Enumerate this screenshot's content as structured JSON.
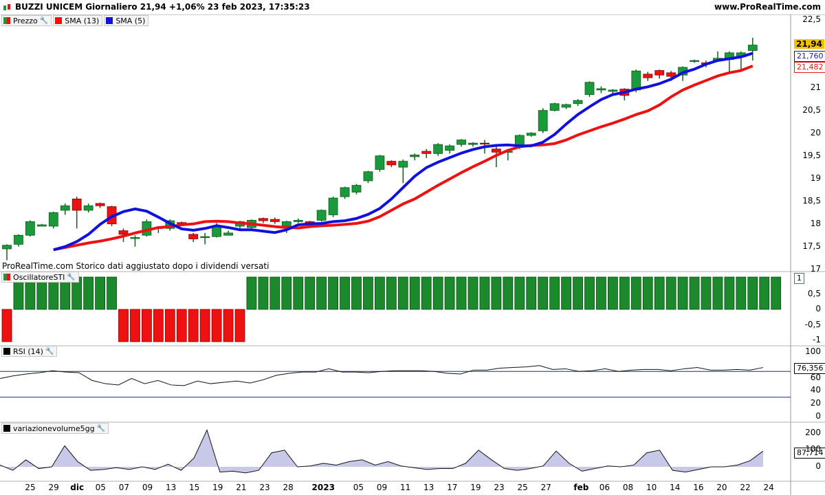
{
  "header": {
    "title": "BUZZI UNICEM Giornaliero 21,94 +1,06% 23 feb 2023, 17:35:23",
    "site": "www.ProRealTime.com"
  },
  "price_panel": {
    "legend": [
      {
        "label": "Prezzo",
        "color": "#1a9a3a",
        "icon": "candle-icon"
      },
      {
        "label": "SMA (13)",
        "color": "#ee1111",
        "icon": "square"
      },
      {
        "label": "SMA (5)",
        "color": "#1111dd",
        "icon": "square"
      }
    ],
    "footnote": "ProRealTime.com  Storico dati aggiustato dopo i dividendi versati",
    "last_price": "21,94",
    "sma5_value": "21,760",
    "sma13_value": "21,482",
    "y_ticks": [
      "22,5",
      "22",
      "21,5",
      "21",
      "20,5",
      "20",
      "19,5",
      "19",
      "18,5",
      "18",
      "17,5",
      "17"
    ]
  },
  "sti_panel": {
    "legend": "OscillatoreSTI",
    "value": "1",
    "y_ticks": [
      "0,5",
      "0",
      "-0,5",
      "-1"
    ]
  },
  "rsi_panel": {
    "legend": "RSI (14)",
    "value": "76,356",
    "y_ticks": [
      "100",
      "80",
      "60",
      "40",
      "20",
      "0"
    ]
  },
  "vol_panel": {
    "legend": "variazionevolume5gg",
    "value": "87,714",
    "y_ticks": [
      "200",
      "100",
      "0"
    ]
  },
  "x_axis": {
    "labels": [
      {
        "t": "25",
        "i": 2,
        "bold": false
      },
      {
        "t": "29",
        "i": 4,
        "bold": false
      },
      {
        "t": "dic",
        "i": 6,
        "bold": true
      },
      {
        "t": "05",
        "i": 8,
        "bold": false
      },
      {
        "t": "07",
        "i": 10,
        "bold": false
      },
      {
        "t": "09",
        "i": 12,
        "bold": false
      },
      {
        "t": "13",
        "i": 14,
        "bold": false
      },
      {
        "t": "15",
        "i": 16,
        "bold": false
      },
      {
        "t": "19",
        "i": 18,
        "bold": false
      },
      {
        "t": "21",
        "i": 20,
        "bold": false
      },
      {
        "t": "23",
        "i": 22,
        "bold": false
      },
      {
        "t": "28",
        "i": 24,
        "bold": false
      },
      {
        "t": "2023",
        "i": 27,
        "bold": true
      },
      {
        "t": "05",
        "i": 30,
        "bold": false
      },
      {
        "t": "09",
        "i": 32,
        "bold": false
      },
      {
        "t": "11",
        "i": 34,
        "bold": false
      },
      {
        "t": "13",
        "i": 36,
        "bold": false
      },
      {
        "t": "17",
        "i": 38,
        "bold": false
      },
      {
        "t": "19",
        "i": 40,
        "bold": false
      },
      {
        "t": "23",
        "i": 42,
        "bold": false
      },
      {
        "t": "25",
        "i": 44,
        "bold": false
      },
      {
        "t": "27",
        "i": 46,
        "bold": false
      },
      {
        "t": "feb",
        "i": 49,
        "bold": true
      },
      {
        "t": "06",
        "i": 51,
        "bold": false
      },
      {
        "t": "08",
        "i": 53,
        "bold": false
      },
      {
        "t": "10",
        "i": 55,
        "bold": false
      },
      {
        "t": "14",
        "i": 57,
        "bold": false
      },
      {
        "t": "16",
        "i": 59,
        "bold": false
      },
      {
        "t": "20",
        "i": 61,
        "bold": false
      },
      {
        "t": "22",
        "i": 63,
        "bold": false
      },
      {
        "t": "24",
        "i": 65,
        "bold": false
      }
    ]
  },
  "chart_data": {
    "type": "candlestick",
    "ylim": [
      16.95,
      22.6
    ],
    "candles": [
      [
        17.45,
        17.53,
        17.2,
        17.55
      ],
      [
        17.55,
        17.75,
        17.5,
        17.77
      ],
      [
        17.75,
        18.05,
        17.72,
        18.08
      ],
      [
        17.95,
        17.98,
        17.95,
        18.0
      ],
      [
        17.95,
        18.25,
        17.9,
        18.27
      ],
      [
        18.3,
        18.4,
        18.2,
        18.45
      ],
      [
        18.55,
        18.3,
        17.9,
        18.6
      ],
      [
        18.3,
        18.4,
        18.25,
        18.45
      ],
      [
        18.45,
        18.4,
        18.35,
        18.47
      ],
      [
        18.38,
        18.0,
        17.95,
        18.4
      ],
      [
        17.85,
        17.77,
        17.6,
        17.9
      ],
      [
        17.7,
        17.7,
        17.5,
        17.75
      ],
      [
        17.75,
        18.05,
        17.72,
        18.1
      ],
      [
        17.92,
        17.92,
        17.8,
        17.95
      ],
      [
        17.9,
        18.07,
        17.85,
        18.1
      ],
      [
        18.03,
        18.0,
        17.95,
        18.05
      ],
      [
        17.77,
        17.67,
        17.6,
        17.8
      ],
      [
        17.72,
        17.72,
        17.55,
        17.8
      ],
      [
        17.72,
        17.95,
        17.7,
        18.02
      ],
      [
        17.75,
        17.8,
        17.75,
        17.85
      ],
      [
        17.95,
        18.05,
        17.9,
        18.07
      ],
      [
        17.92,
        18.08,
        17.9,
        18.1
      ],
      [
        18.12,
        18.07,
        18.02,
        18.14
      ],
      [
        18.1,
        18.05,
        18.0,
        18.14
      ],
      [
        17.95,
        18.05,
        17.8,
        18.07
      ],
      [
        18.05,
        18.08,
        18.02,
        18.12
      ],
      [
        18.05,
        18.02,
        18.0,
        18.07
      ],
      [
        18.08,
        18.3,
        18.05,
        18.32
      ],
      [
        18.2,
        18.57,
        18.15,
        18.6
      ],
      [
        18.6,
        18.8,
        18.55,
        18.82
      ],
      [
        18.7,
        18.85,
        18.65,
        18.88
      ],
      [
        18.95,
        19.15,
        18.9,
        19.17
      ],
      [
        19.2,
        19.5,
        19.15,
        19.52
      ],
      [
        19.38,
        19.3,
        19.25,
        19.4
      ],
      [
        19.25,
        19.38,
        18.9,
        19.42
      ],
      [
        19.48,
        19.52,
        19.4,
        19.55
      ],
      [
        19.6,
        19.55,
        19.45,
        19.65
      ],
      [
        19.55,
        19.75,
        19.5,
        19.78
      ],
      [
        19.62,
        19.72,
        19.55,
        19.75
      ],
      [
        19.75,
        19.85,
        19.7,
        19.87
      ],
      [
        19.75,
        19.78,
        19.7,
        19.8
      ],
      [
        19.78,
        19.77,
        19.55,
        19.85
      ],
      [
        19.65,
        19.58,
        19.25,
        19.7
      ],
      [
        19.58,
        19.6,
        19.4,
        19.62
      ],
      [
        19.7,
        19.95,
        19.65,
        19.97
      ],
      [
        19.95,
        20.0,
        19.92,
        20.02
      ],
      [
        20.05,
        20.5,
        20.0,
        20.55
      ],
      [
        20.5,
        20.65,
        20.48,
        20.67
      ],
      [
        20.57,
        20.63,
        20.53,
        20.65
      ],
      [
        20.65,
        20.72,
        20.6,
        20.75
      ],
      [
        20.85,
        21.12,
        20.8,
        21.14
      ],
      [
        20.95,
        20.98,
        20.88,
        21.03
      ],
      [
        20.92,
        20.95,
        20.85,
        20.97
      ],
      [
        20.97,
        20.83,
        20.72,
        20.99
      ],
      [
        20.95,
        21.37,
        20.9,
        21.4
      ],
      [
        21.3,
        21.22,
        21.15,
        21.35
      ],
      [
        21.38,
        21.28,
        21.2,
        21.4
      ],
      [
        21.33,
        21.25,
        21.15,
        21.37
      ],
      [
        21.28,
        21.45,
        21.15,
        21.47
      ],
      [
        21.58,
        21.6,
        21.55,
        21.62
      ],
      [
        21.55,
        21.52,
        21.45,
        21.6
      ],
      [
        21.6,
        21.65,
        21.58,
        21.8
      ],
      [
        21.62,
        21.77,
        21.35,
        21.8
      ],
      [
        21.68,
        21.77,
        21.35,
        21.8
      ],
      [
        21.82,
        21.94,
        21.6,
        22.1
      ]
    ],
    "sma13": [
      17.43,
      17.48,
      17.53,
      17.58,
      17.62,
      17.67,
      17.73,
      17.8,
      17.86,
      17.92,
      17.94,
      17.98,
      18.0,
      18.05,
      18.06,
      18.05,
      18.02,
      18.0,
      17.97,
      17.94,
      17.92,
      17.91,
      17.94,
      17.96,
      17.97,
      17.99,
      18.01,
      18.06,
      18.16,
      18.3,
      18.44,
      18.55,
      18.7,
      18.85,
      18.99,
      19.13,
      19.26,
      19.38,
      19.51,
      19.62,
      19.7,
      19.73,
      19.74,
      19.77,
      19.85,
      19.96,
      20.05,
      20.14,
      20.22,
      20.31,
      20.41,
      20.49,
      20.62,
      20.8,
      20.95,
      21.06,
      21.16,
      21.26,
      21.33,
      21.38,
      21.48
    ],
    "sma5": [
      17.43,
      17.5,
      17.61,
      17.77,
      17.99,
      18.16,
      18.27,
      18.33,
      18.28,
      18.15,
      18.01,
      17.89,
      17.86,
      17.9,
      17.96,
      17.92,
      17.87,
      17.87,
      17.84,
      17.81,
      17.87,
      17.98,
      18.0,
      18.01,
      18.05,
      18.07,
      18.12,
      18.21,
      18.34,
      18.55,
      18.8,
      19.05,
      19.24,
      19.36,
      19.46,
      19.56,
      19.64,
      19.7,
      19.73,
      19.74,
      19.72,
      19.72,
      19.8,
      19.97,
      20.2,
      20.41,
      20.58,
      20.74,
      20.85,
      20.9,
      20.97,
      21.02,
      21.09,
      21.19,
      21.33,
      21.41,
      21.52,
      21.6,
      21.64,
      21.68,
      21.76
    ],
    "sti": [
      -1,
      1,
      1,
      1,
      1,
      1,
      1,
      1,
      1,
      1,
      -1,
      -1,
      -1,
      -1,
      -1,
      -1,
      -1,
      -1,
      -1,
      -1,
      -1,
      1,
      1,
      1,
      1,
      1,
      1,
      1,
      1,
      1,
      1,
      1,
      1,
      1,
      1,
      1,
      1,
      1,
      1,
      1,
      1,
      1,
      1,
      1,
      1,
      1,
      1,
      1,
      1,
      1,
      1,
      1,
      1,
      1,
      1,
      1,
      1,
      1,
      1,
      1,
      1,
      1,
      1,
      1,
      1,
      1,
      1
    ],
    "rsi": [
      59,
      63,
      66,
      68,
      71,
      69,
      68,
      56,
      51,
      49,
      59,
      51,
      56,
      49,
      48,
      55,
      51,
      53,
      55,
      52,
      57,
      64,
      67,
      69,
      69,
      74,
      69,
      69,
      68,
      70,
      71,
      71,
      71,
      70,
      67,
      66,
      72,
      72,
      75,
      76,
      77,
      79,
      73,
      74,
      70,
      71,
      74,
      70,
      72,
      73,
      73,
      71,
      74,
      76,
      72,
      72,
      73,
      72,
      76
    ],
    "rsi_levels": [
      70,
      30
    ],
    "volume_change": [
      10,
      -20,
      40,
      -10,
      0,
      120,
      30,
      -20,
      -15,
      -5,
      -15,
      0,
      -15,
      15,
      -20,
      50,
      210,
      -30,
      -25,
      -35,
      -20,
      80,
      95,
      0,
      5,
      20,
      10,
      30,
      40,
      10,
      30,
      5,
      -5,
      -15,
      -10,
      -10,
      20,
      95,
      40,
      -10,
      -20,
      -10,
      5,
      90,
      20,
      -25,
      -10,
      5,
      0,
      10,
      80,
      95,
      -20,
      -30,
      -15,
      0,
      0,
      10,
      35,
      90
    ],
    "volume_ylim": [
      -40,
      260
    ]
  }
}
